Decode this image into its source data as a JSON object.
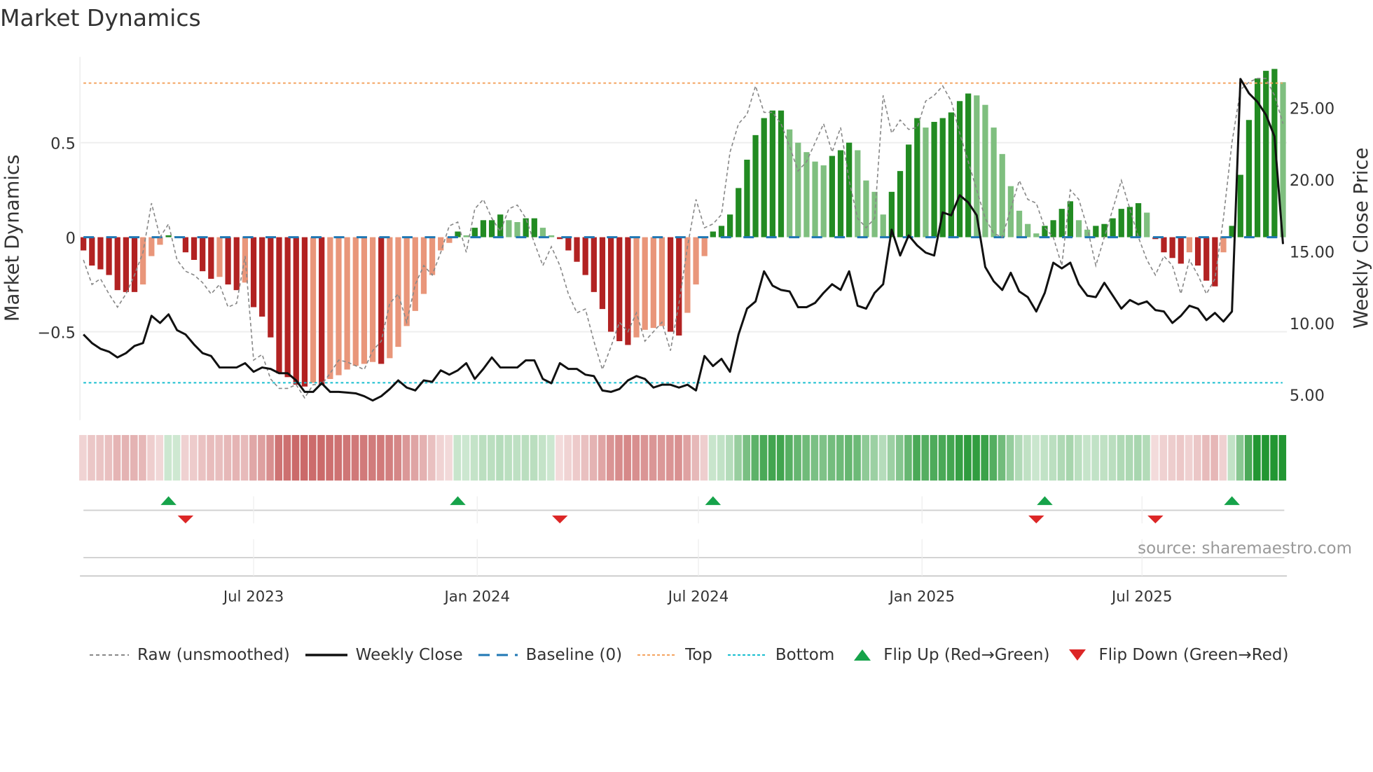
{
  "title": "Market Dynamics",
  "source": "source: sharemaestro.com",
  "colors": {
    "dark_red": "#b22222",
    "light_red": "#e9967a",
    "dark_green": "#228b22",
    "light_green": "#7fbf7f",
    "raw": "#888888",
    "close": "#111111",
    "baseline": "#1f77b4",
    "top": "#f4a460",
    "bottom": "#17becf",
    "flip_up": "#16a34a",
    "flip_down": "#dc2626"
  },
  "legend": [
    {
      "label": "Raw (unsmoothed)",
      "icon": "dashed-gray-line"
    },
    {
      "label": "Weekly Close",
      "icon": "solid-black-line"
    },
    {
      "label": "Baseline (0)",
      "icon": "dashed-blue-line"
    },
    {
      "label": "Top",
      "icon": "dotted-orange-line"
    },
    {
      "label": "Bottom",
      "icon": "dotted-cyan-line"
    },
    {
      "label": "Flip Up (Red→Green)",
      "icon": "green-triangle-up"
    },
    {
      "label": "Flip Down (Green→Red)",
      "icon": "red-triangle-down"
    }
  ],
  "chart_data": {
    "type": "bar",
    "title": "Market Dynamics",
    "ylabel": "Market Dynamics",
    "y2label": "Weekly Close Price",
    "start_date": "2023-02-11",
    "frequency": "weekly",
    "ylim": [
      -0.95,
      0.95
    ],
    "y_ticks": [
      {
        "value": 0.5,
        "label": "0.5"
      },
      {
        "value": 0,
        "label": "0"
      },
      {
        "value": -0.5,
        "label": "−0.5"
      }
    ],
    "y2lim": [
      3.2,
      28.7
    ],
    "y2_ticks": [
      {
        "value": 25,
        "label": "25.00"
      },
      {
        "value": 20,
        "label": "20.00"
      },
      {
        "value": 15,
        "label": "15.00"
      },
      {
        "value": 10,
        "label": "10.00"
      },
      {
        "value": 5,
        "label": "5.00"
      }
    ],
    "x_ticks": [
      {
        "date": "2023-07-01",
        "label": "Jul 2023"
      },
      {
        "date": "2024-01-01",
        "label": "Jan 2024"
      },
      {
        "date": "2024-07-01",
        "label": "Jul 2024"
      },
      {
        "date": "2025-01-01",
        "label": "Jan 2025"
      },
      {
        "date": "2025-07-01",
        "label": "Jul 2025"
      }
    ],
    "top_level": 0.815,
    "bottom_level": -0.77,
    "baseline": 0,
    "momentum": [
      -0.07,
      -0.15,
      -0.17,
      -0.2,
      -0.28,
      -0.29,
      -0.29,
      -0.25,
      -0.1,
      -0.04,
      0.01,
      0.005,
      -0.08,
      -0.12,
      -0.18,
      -0.22,
      -0.21,
      -0.25,
      -0.28,
      -0.24,
      -0.37,
      -0.42,
      -0.53,
      -0.72,
      -0.74,
      -0.78,
      -0.79,
      -0.77,
      -0.78,
      -0.75,
      -0.73,
      -0.7,
      -0.68,
      -0.67,
      -0.66,
      -0.67,
      -0.64,
      -0.58,
      -0.47,
      -0.39,
      -0.3,
      -0.2,
      -0.07,
      -0.03,
      0.03,
      0.01,
      0.05,
      0.09,
      0.09,
      0.12,
      0.09,
      0.08,
      0.1,
      0.1,
      0.05,
      0.01,
      -0.01,
      -0.07,
      -0.13,
      -0.2,
      -0.29,
      -0.38,
      -0.5,
      -0.55,
      -0.57,
      -0.53,
      -0.49,
      -0.48,
      -0.47,
      -0.5,
      -0.52,
      -0.4,
      -0.25,
      -0.1,
      0.03,
      0.06,
      0.12,
      0.26,
      0.41,
      0.54,
      0.63,
      0.67,
      0.67,
      0.57,
      0.5,
      0.45,
      0.4,
      0.38,
      0.43,
      0.46,
      0.5,
      0.46,
      0.3,
      0.24,
      0.12,
      0.24,
      0.35,
      0.49,
      0.63,
      0.58,
      0.61,
      0.63,
      0.66,
      0.72,
      0.76,
      0.75,
      0.7,
      0.58,
      0.44,
      0.27,
      0.14,
      0.07,
      0.02,
      0.06,
      0.09,
      0.15,
      0.19,
      0.09,
      0.04,
      0.06,
      0.07,
      0.1,
      0.15,
      0.16,
      0.18,
      0.13,
      -0.01,
      -0.08,
      -0.11,
      -0.14,
      -0.08,
      -0.15,
      -0.23,
      -0.26,
      -0.08,
      0.06,
      0.33,
      0.62,
      0.84,
      0.88,
      0.89,
      0.82
    ],
    "raw": [
      -0.12,
      -0.25,
      -0.22,
      -0.3,
      -0.37,
      -0.3,
      -0.2,
      -0.08,
      0.18,
      0.0,
      0.07,
      -0.12,
      -0.18,
      -0.2,
      -0.24,
      -0.3,
      -0.25,
      -0.37,
      -0.35,
      -0.1,
      -0.65,
      -0.62,
      -0.75,
      -0.8,
      -0.8,
      -0.78,
      -0.85,
      -0.78,
      -0.78,
      -0.72,
      -0.65,
      -0.66,
      -0.68,
      -0.7,
      -0.6,
      -0.55,
      -0.35,
      -0.3,
      -0.45,
      -0.25,
      -0.15,
      -0.2,
      -0.08,
      0.06,
      0.08,
      -0.08,
      0.15,
      0.2,
      0.1,
      0.03,
      0.15,
      0.17,
      0.1,
      -0.03,
      -0.15,
      -0.05,
      -0.15,
      -0.3,
      -0.4,
      -0.38,
      -0.55,
      -0.7,
      -0.58,
      -0.45,
      -0.5,
      -0.4,
      -0.55,
      -0.5,
      -0.45,
      -0.6,
      -0.35,
      -0.05,
      0.2,
      0.05,
      0.07,
      0.12,
      0.45,
      0.6,
      0.65,
      0.8,
      0.66,
      0.66,
      0.6,
      0.48,
      0.35,
      0.4,
      0.5,
      0.6,
      0.45,
      0.58,
      0.3,
      0.1,
      0.05,
      0.1,
      0.75,
      0.55,
      0.62,
      0.57,
      0.58,
      0.72,
      0.75,
      0.8,
      0.72,
      0.55,
      0.4,
      0.25,
      0.1,
      0.02,
      0.0,
      0.15,
      0.3,
      0.2,
      0.18,
      0.05,
      0.0,
      -0.15,
      0.25,
      0.2,
      0.05,
      -0.15,
      0.0,
      0.15,
      0.3,
      0.15,
      0.0,
      -0.12,
      -0.2,
      -0.1,
      -0.15,
      -0.3,
      -0.12,
      -0.2,
      -0.3,
      -0.22,
      0.1,
      0.5,
      0.78,
      0.82,
      0.84,
      0.84,
      0.75,
      0.6
    ],
    "close": [
      9.2,
      8.6,
      8.2,
      8.0,
      7.6,
      7.9,
      8.4,
      8.6,
      10.5,
      10.0,
      10.6,
      9.5,
      9.2,
      8.5,
      7.9,
      7.7,
      6.9,
      6.9,
      6.9,
      7.2,
      6.6,
      6.9,
      6.8,
      6.5,
      6.5,
      6.0,
      5.2,
      5.2,
      5.8,
      5.2,
      5.2,
      5.15,
      5.1,
      4.9,
      4.6,
      4.9,
      5.4,
      6.0,
      5.5,
      5.3,
      6.0,
      5.9,
      6.7,
      6.4,
      6.7,
      7.2,
      6.1,
      6.8,
      7.6,
      6.9,
      6.9,
      6.9,
      7.4,
      7.4,
      6.1,
      5.8,
      7.2,
      6.8,
      6.8,
      6.4,
      6.3,
      5.3,
      5.2,
      5.4,
      6.0,
      6.3,
      6.1,
      5.5,
      5.7,
      5.7,
      5.5,
      5.7,
      5.3,
      7.7,
      7.0,
      7.5,
      6.6,
      9.2,
      11.0,
      11.5,
      13.6,
      12.6,
      12.3,
      12.2,
      11.1,
      11.1,
      11.4,
      12.1,
      12.7,
      12.3,
      13.6,
      11.2,
      11.0,
      12.1,
      12.7,
      16.5,
      14.7,
      16.1,
      15.4,
      14.9,
      14.7,
      17.7,
      17.5,
      18.9,
      18.4,
      17.5,
      13.9,
      12.9,
      12.3,
      13.5,
      12.2,
      11.8,
      10.8,
      12.1,
      14.2,
      13.8,
      14.2,
      12.7,
      11.9,
      11.8,
      12.8,
      11.9,
      11.0,
      11.6,
      11.3,
      11.5,
      10.9,
      10.8,
      10.0,
      10.5,
      11.2,
      11.0,
      10.2,
      10.7,
      10.1,
      10.8,
      27.0,
      26.0,
      25.4,
      24.5,
      23.0,
      15.5
    ],
    "flip_up_weeks": [
      10,
      44,
      74,
      113,
      135
    ],
    "flip_down_weeks": [
      12,
      56,
      112,
      126
    ]
  }
}
